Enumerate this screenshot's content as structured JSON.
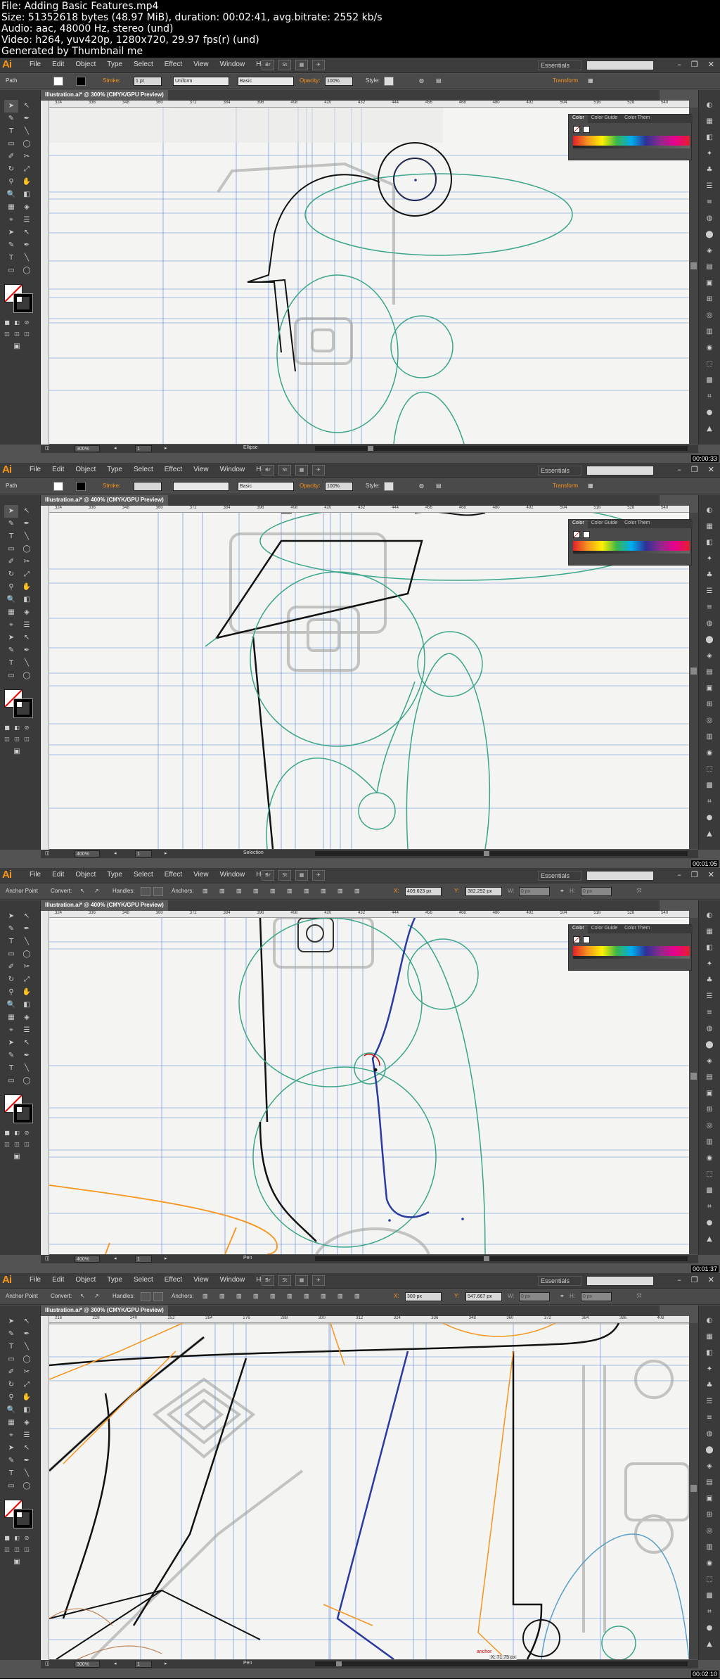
{
  "header": {
    "lines": [
      "File: Adding Basic Features.mp4",
      "Size: 51352618 bytes (48.97 MiB), duration: 00:02:41, avg.bitrate: 2552 kb/s",
      "Audio: aac, 48000 Hz, stereo (und)",
      "Video: h264, yuv420p, 1280x720, 29.97 fps(r) (und)",
      "Generated by Thumbnail me"
    ]
  },
  "app": {
    "logo": "Ai",
    "menus": [
      "File",
      "Edit",
      "Object",
      "Type",
      "Select",
      "Effect",
      "View",
      "Window",
      "Help"
    ],
    "workspace": "Essentials",
    "window_controls": [
      "–",
      "❐",
      "✕"
    ],
    "buttons": [
      "Br",
      "St"
    ]
  },
  "colors": {
    "accent": "#f7941d",
    "guide": "#4a7fd4",
    "sketch_green": "#3aa58a",
    "sketch_orange": "#f7941d"
  },
  "frames": [
    {
      "control_label": "Path",
      "stroke_label": "Stroke:",
      "stroke_value": "1 pt",
      "stroke_style": "Uniform",
      "brush_style": "Basic",
      "opacity_label": "Opacity:",
      "opacity_value": "100%",
      "style_label": "Style:",
      "transform_label": "Transform",
      "doc_tab": "Illustration.ai* @ 300% (CMYK/GPU Preview)",
      "zoom": "300%",
      "page": "1",
      "tool_name": "Ellipse",
      "timestamp": "00:00:33",
      "ruler_ticks": [
        "324",
        "336",
        "348",
        "360",
        "372",
        "384",
        "396",
        "408",
        "420",
        "432",
        "444",
        "456",
        "468",
        "480",
        "492",
        "504",
        "516",
        "528",
        "540"
      ],
      "panel_tabs": [
        "Color",
        "Color Guide",
        "Color Them"
      ]
    },
    {
      "control_label": "Path",
      "stroke_label": "Stroke:",
      "stroke_value": "",
      "stroke_style": "",
      "brush_style": "Basic",
      "opacity_label": "Opacity:",
      "opacity_value": "100%",
      "style_label": "Style:",
      "transform_label": "Transform",
      "doc_tab": "Illustration.ai* @ 400% (CMYK/GPU Preview)",
      "zoom": "400%",
      "page": "1",
      "tool_name": "Selection",
      "timestamp": "00:01:05",
      "ruler_ticks": [
        "324",
        "336",
        "348",
        "360",
        "372",
        "384",
        "396",
        "408",
        "420",
        "432",
        "444",
        "456",
        "468",
        "480",
        "492",
        "504",
        "516",
        "528",
        "540"
      ],
      "panel_tabs": [
        "Color",
        "Color Guide",
        "Color Them"
      ]
    },
    {
      "control_label": "Anchor Point",
      "convert_label": "Convert:",
      "handles_label": "Handles:",
      "anchors_label": "Anchors:",
      "x_value": "409.623 px",
      "y_value": "382.292 px",
      "w_value": "0 px",
      "h_value": "0 px",
      "doc_tab": "Illustration.ai* @ 400% (CMYK/GPU Preview)",
      "zoom": "400%",
      "page": "1",
      "tool_name": "Pen",
      "timestamp": "00:01:37",
      "ruler_ticks": [
        "324",
        "336",
        "348",
        "360",
        "372",
        "384",
        "396",
        "408",
        "420",
        "432",
        "444",
        "456",
        "468",
        "480",
        "492",
        "504",
        "516",
        "528",
        "540"
      ],
      "panel_tabs": [
        "Color",
        "Color Guide",
        "Color Them"
      ]
    },
    {
      "control_label": "Anchor Point",
      "convert_label": "Convert:",
      "handles_label": "Handles:",
      "anchors_label": "Anchors:",
      "x_value": "300 px",
      "y_value": "547.667 px",
      "w_value": "0 px",
      "h_value": "0 px",
      "doc_tab": "Illustration.ai* @ 300% (CMYK/GPU Preview)",
      "zoom": "300%",
      "page": "1",
      "tool_name": "Pen",
      "timestamp": "00:02:10",
      "ruler_ticks": [
        "216",
        "228",
        "240",
        "252",
        "264",
        "276",
        "288",
        "300",
        "312",
        "324",
        "336",
        "348",
        "360",
        "372",
        "384",
        "396",
        "408"
      ],
      "panel_tabs": [],
      "cursor_label": "anchor",
      "cursor_coords": "X: 71.75 px"
    }
  ]
}
